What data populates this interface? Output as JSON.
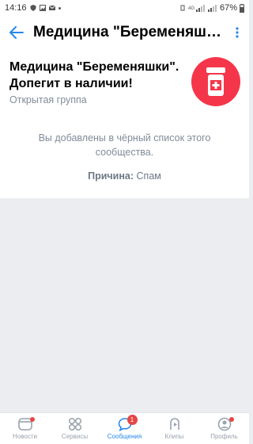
{
  "status_bar": {
    "time": "14:16",
    "battery": "67%"
  },
  "header": {
    "title": "Медицина \"Беременяшки\". Допегит в наличии!"
  },
  "group": {
    "name": "Медицина \"Беременяшки\". Допегит в наличии!",
    "type": "Открытая группа",
    "avatar_color": "#f5364a"
  },
  "blacklist": {
    "message": "Вы добавлены в чёрный список этого сообщества.",
    "reason_label": "Причина:",
    "reason_value": " Спам"
  },
  "tabs": [
    {
      "label": "Новости",
      "icon": "news-icon"
    },
    {
      "label": "Сервисы",
      "icon": "services-icon"
    },
    {
      "label": "Сообщения",
      "icon": "messages-icon",
      "badge": "1",
      "active": true
    },
    {
      "label": "Клипы",
      "icon": "clips-icon"
    },
    {
      "label": "Профиль",
      "icon": "profile-icon"
    }
  ],
  "colors": {
    "accent": "#2688eb",
    "secondary_text": "#818c99",
    "badge": "#e64646"
  }
}
